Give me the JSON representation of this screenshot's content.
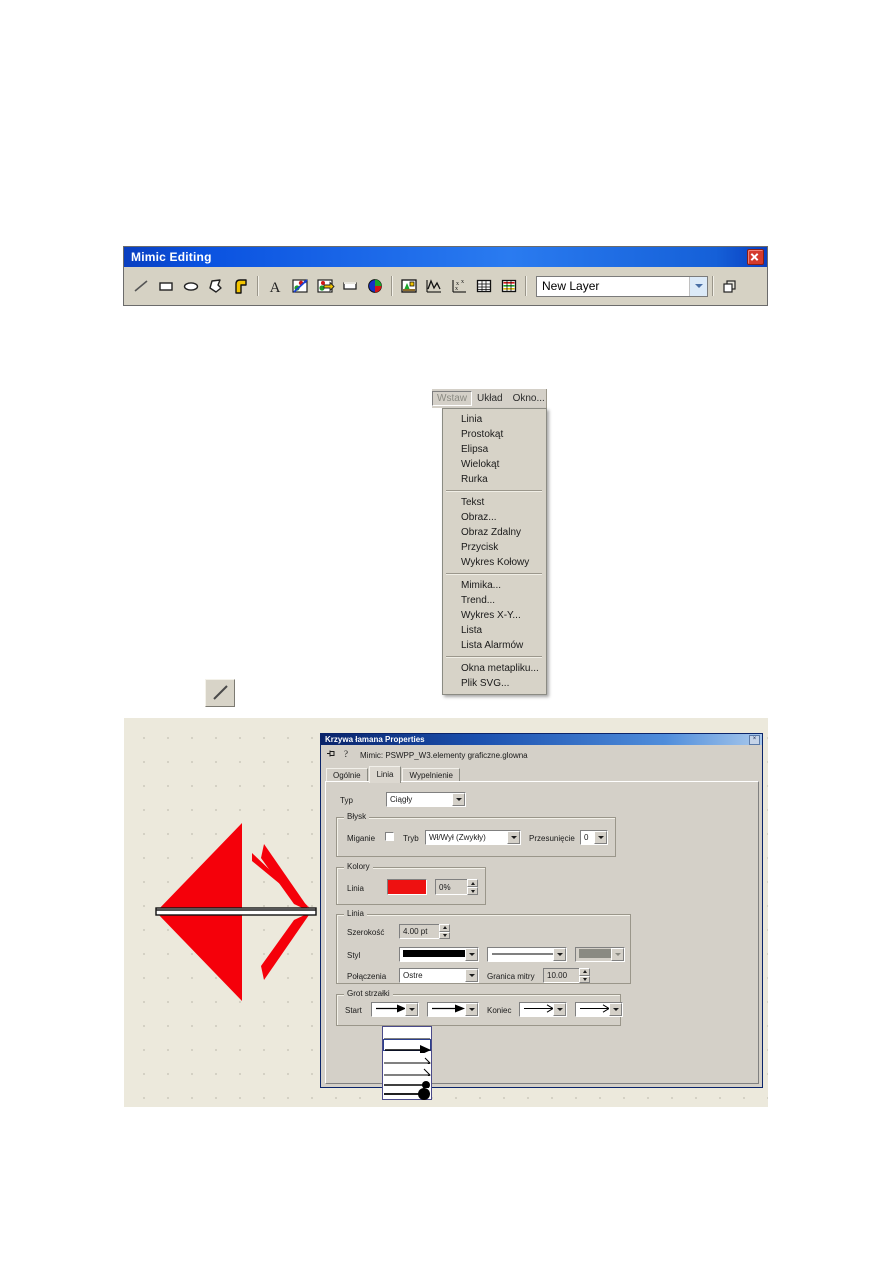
{
  "toolbar": {
    "title": "Mimic Editing",
    "close_icon": "close-icon",
    "tools": [
      {
        "name": "line-tool",
        "icon": "line-icon"
      },
      {
        "name": "rectangle-tool",
        "icon": "rectangle-icon"
      },
      {
        "name": "ellipse-tool",
        "icon": "ellipse-icon"
      },
      {
        "name": "polygon-tool",
        "icon": "polygon-icon"
      },
      {
        "name": "pipe-tool",
        "icon": "pipe-icon"
      },
      {
        "name": "text-tool",
        "icon": "text-a-icon"
      },
      {
        "name": "image-tool",
        "icon": "image-pencil-icon"
      },
      {
        "name": "remote-image-tool",
        "icon": "image-arrow-icon"
      },
      {
        "name": "button-tool",
        "icon": "button-icon"
      },
      {
        "name": "pie-chart-tool",
        "icon": "pie-chart-icon"
      },
      {
        "name": "mimic-tool",
        "icon": "mimic-picture-icon"
      },
      {
        "name": "trend-tool",
        "icon": "trend-graph-icon"
      },
      {
        "name": "xy-plot-tool",
        "icon": "xy-plot-icon"
      },
      {
        "name": "list-tool",
        "icon": "grid-table-icon"
      },
      {
        "name": "alarm-list-tool",
        "icon": "alarm-table-icon"
      }
    ],
    "layer_value": "New Layer",
    "layer_placeholder": "New Layer",
    "duplicate_icon": "duplicate-windows-icon"
  },
  "menu": {
    "bar": [
      {
        "label": "Wstaw",
        "pressed": true
      },
      {
        "label": "Układ",
        "pressed": false
      },
      {
        "label": "Okno...",
        "pressed": false
      }
    ],
    "groups": [
      [
        "Linia",
        "Prostokąt",
        "Elipsa",
        "Wielokąt",
        "Rurka"
      ],
      [
        "Tekst",
        "Obraz...",
        "Obraz Zdalny",
        "Przycisk",
        "Wykres Kołowy"
      ],
      [
        "Mimika...",
        "Trend...",
        "Wykres X-Y...",
        "Lista",
        "Lista Alarmów"
      ],
      [
        "Okna metapliku...",
        "Plik SVG..."
      ]
    ]
  },
  "line_tool_button": {
    "name": "line-tool-button",
    "icon": "diagonal-line-icon"
  },
  "canvas": {
    "shape": "double-headed-arrow",
    "shape_color": "#f5000a",
    "selected": true,
    "background": "#ece9dc"
  },
  "dialog": {
    "title": "Krzywa łamana Properties",
    "close_label": "×",
    "pin_icon": "pushpin-icon",
    "help_icon": "help-question-icon",
    "path": "Mimic: PSWPP_W3.elementy graficzne.glowna",
    "tabs": [
      {
        "label": "Ogólnie",
        "active": false
      },
      {
        "label": "Linia",
        "active": true
      },
      {
        "label": "Wypelnienie",
        "active": false
      }
    ],
    "typ": {
      "label": "Typ",
      "value": "Ciągły"
    },
    "blysk": {
      "group_label": "Błysk",
      "miganie_label": "Miganie",
      "miganie_checked": false,
      "tryb_label": "Tryb",
      "tryb_value": "Wł/Wył (Zwykły)",
      "przesuniecie_label": "Przesunięcie",
      "przesuniecie_value": "0"
    },
    "kolory": {
      "group_label": "Kolory",
      "linia_label": "Linia",
      "linia_color": "#ee1111",
      "percent_value": "0%"
    },
    "linia": {
      "group_label": "Linia",
      "szerokosc_label": "Szerokość",
      "szerokosc_value": "4.00 pt",
      "styl_label": "Styl",
      "styl_value_1": "solid-thick-black",
      "styl_value_2": "thin-line",
      "styl_value_3": "gray-block-disabled",
      "polaczenia_label": "Połączenia",
      "polaczenia_value": "Ostre",
      "granica_label": "Granica mitry",
      "granica_value": "10.00"
    },
    "grot": {
      "group_label": "Grot strzałki",
      "start_label": "Start",
      "koniec_label": "Koniec",
      "start_1": "filled-arrow-head",
      "start_2": "filled-arrow-head",
      "koniec_1": "open-arrow-head",
      "koniec_2": "open-arrow-head"
    },
    "arrow_dropdown": {
      "open": true,
      "options": [
        {
          "name": "none-arrow",
          "selected": false
        },
        {
          "name": "filled-triangle-arrow",
          "selected": true
        },
        {
          "name": "thin-open-arrow-small",
          "selected": false
        },
        {
          "name": "thin-open-arrow",
          "selected": false
        },
        {
          "name": "small-dot-end",
          "selected": false
        },
        {
          "name": "large-dot-end",
          "selected": false
        }
      ]
    }
  }
}
